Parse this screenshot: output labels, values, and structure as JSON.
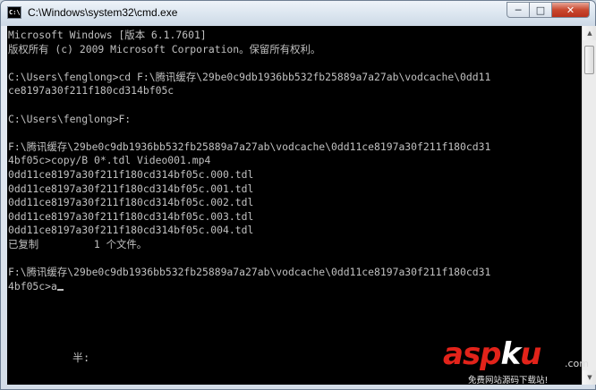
{
  "window": {
    "title": "C:\\Windows\\system32\\cmd.exe",
    "icon": "cmd-icon",
    "icon_text": "C:\\"
  },
  "caption_buttons": {
    "minimize": "─",
    "maximize": "□",
    "close": "✕"
  },
  "console": {
    "lines": [
      "Microsoft Windows [版本 6.1.7601]",
      "版权所有 (c) 2009 Microsoft Corporation。保留所有权利。",
      "",
      "C:\\Users\\fenglong>cd F:\\腾讯缓存\\29be0c9db1936bb532fb25889a7a27ab\\vodcache\\0dd11",
      "ce8197a30f211f180cd314bf05c",
      "",
      "C:\\Users\\fenglong>F:",
      "",
      "F:\\腾讯缓存\\29be0c9db1936bb532fb25889a7a27ab\\vodcache\\0dd11ce8197a30f211f180cd31",
      "4bf05c>copy/B 0*.tdl Video001.mp4",
      "0dd11ce8197a30f211f180cd314bf05c.000.tdl",
      "0dd11ce8197a30f211f180cd314bf05c.001.tdl",
      "0dd11ce8197a30f211f180cd314bf05c.002.tdl",
      "0dd11ce8197a30f211f180cd314bf05c.003.tdl",
      "0dd11ce8197a30f211f180cd314bf05c.004.tdl",
      "已复制         1 个文件。",
      "",
      "F:\\腾讯缓存\\29be0c9db1936bb532fb25889a7a27ab\\vodcache\\0dd11ce8197a30f211f180cd31"
    ],
    "prompt": "4bf05c>",
    "input": "a",
    "ime_status": "半:"
  },
  "watermark": {
    "brand_part1": "asp",
    "brand_part2": "k",
    "brand_part3": "u",
    "dotcom": ".com",
    "subtitle": "免费网站源码下载站!"
  },
  "colors": {
    "console_bg": "#000000",
    "console_fg": "#c0c0c0",
    "close_button": "#c9482f",
    "watermark_red": "#e2231a"
  }
}
